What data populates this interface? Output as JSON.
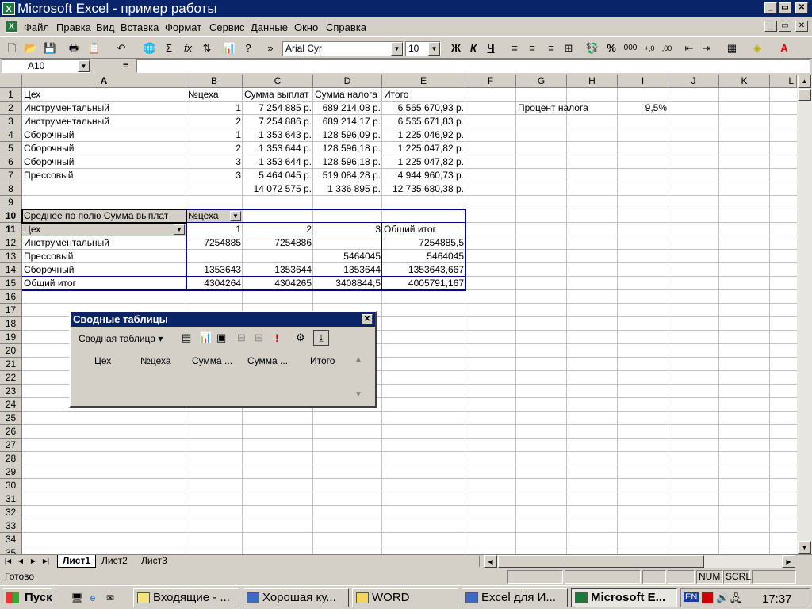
{
  "titlebar": {
    "title": "Microsoft Excel - пример работы",
    "min": "_",
    "max": "▭",
    "close": "✕",
    "icon": "excel-icon"
  },
  "menu": [
    "Файл",
    "Правка",
    "Вид",
    "Вставка",
    "Формат",
    "Сервис",
    "Данные",
    "Окно",
    "Справка"
  ],
  "toolbar": {
    "font": "Arial Cyr",
    "size": "10",
    "bold": "Ж",
    "italic": "К",
    "underline": "Ч",
    "sigma": "Σ",
    "fx": "fx",
    "percent": "%",
    "thousands": "000",
    "dec_inc": "+,0",
    "dec_dec": ",00"
  },
  "formula": {
    "name_box": "A10",
    "eq": "="
  },
  "columns": [
    "A",
    "B",
    "C",
    "D",
    "E",
    "F",
    "G",
    "H",
    "I",
    "J",
    "K",
    "L"
  ],
  "rows": [
    "1",
    "2",
    "3",
    "4",
    "5",
    "6",
    "7",
    "8",
    "9",
    "10",
    "11",
    "12",
    "13",
    "14",
    "15",
    "16",
    "17",
    "18",
    "19",
    "20",
    "21",
    "22",
    "23",
    "24",
    "25",
    "26",
    "27",
    "28",
    "29",
    "30",
    "31",
    "32",
    "33",
    "34",
    "35"
  ],
  "cells": {
    "A1": "Цех",
    "B1": "№цеха",
    "C1": "Сумма выплат",
    "D1": "Сумма налога",
    "E1": "Итого",
    "A2": "Инструментальный",
    "B2": "1",
    "C2": "7 254 885 р.",
    "D2": "689 214,08 р.",
    "E2": "6 565 670,93 р.",
    "G2": "Процент налога",
    "I2": "9,5%",
    "A3": "Инструментальный",
    "B3": "2",
    "C3": "7 254 886 р.",
    "D3": "689 214,17 р.",
    "E3": "6 565 671,83 р.",
    "A4": "Сборочный",
    "B4": "1",
    "C4": "1 353 643 р.",
    "D4": "128 596,09 р.",
    "E4": "1 225 046,92 р.",
    "A5": "Сборочный",
    "B5": "2",
    "C5": "1 353 644 р.",
    "D5": "128 596,18 р.",
    "E5": "1 225 047,82 р.",
    "A6": "Сборочный",
    "B6": "3",
    "C6": "1 353 644 р.",
    "D6": "128 596,18 р.",
    "E6": "1 225 047,82 р.",
    "A7": "Прессовый",
    "B7": "3",
    "C7": "5 464 045 р.",
    "D7": "519 084,28 р.",
    "E7": "4 944 960,73 р.",
    "C8": "14 072 575 р.",
    "D8": "1 336 895 р.",
    "E8": "12 735 680,38 р.",
    "A10": "Среднее по полю Сумма выплат",
    "B10": "№цеха",
    "A11": "Цех",
    "B11": "1",
    "C11": "2",
    "D11": "3",
    "E11": "Общий итог",
    "A12": "Инструментальный",
    "B12": "7254885",
    "C12": "7254886",
    "E12": "7254885,5",
    "A13": "Прессовый",
    "D13": "5464045",
    "E13": "5464045",
    "A14": "Сборочный",
    "B14": "1353643",
    "C14": "1353644",
    "D14": "1353644",
    "E14": "1353643,667",
    "A15": "Общий итог",
    "B15": "4304264",
    "C15": "4304265",
    "D15": "3408844,5",
    "E15": "4005791,167"
  },
  "pivot_toolbar": {
    "title": "Сводные таблицы",
    "close": "✕",
    "menu_label": "Сводная таблица ▾",
    "fields": [
      "Цех",
      "№цеха",
      "Сумма ...",
      "Сумма ...",
      "Итого"
    ]
  },
  "sheets": [
    "Лист1",
    "Лист2",
    "Лист3"
  ],
  "status": {
    "text": "Готово",
    "num": "NUM",
    "scrl": "SCRL"
  },
  "taskbar": {
    "start": "Пуск",
    "buttons": [
      "Входящие - ...",
      "Хорошая ку...",
      "WORD",
      "Excel для И...",
      "Microsoft E..."
    ],
    "lang": "EN",
    "clock": "17:37"
  }
}
